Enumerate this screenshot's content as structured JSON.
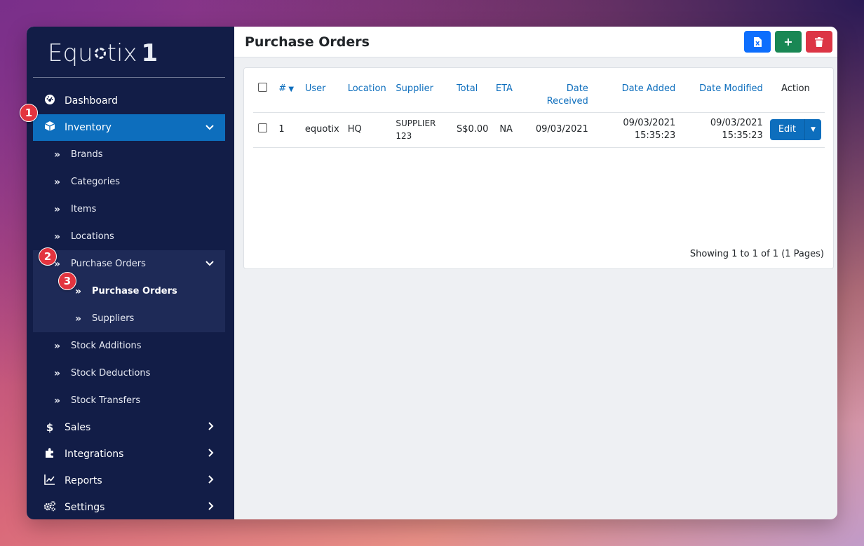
{
  "app": {
    "logo_text": "Equotix",
    "logo_suffix": "1"
  },
  "sidebar": {
    "items": [
      {
        "label": "Dashboard",
        "icon": "dashboard-icon"
      },
      {
        "label": "Inventory",
        "icon": "box-icon"
      },
      {
        "label": "Brands"
      },
      {
        "label": "Categories"
      },
      {
        "label": "Items"
      },
      {
        "label": "Locations"
      },
      {
        "label": "Purchase Orders"
      },
      {
        "label": "Purchase Orders"
      },
      {
        "label": "Suppliers"
      },
      {
        "label": "Stock Additions"
      },
      {
        "label": "Stock Deductions"
      },
      {
        "label": "Stock Transfers"
      },
      {
        "label": "Sales",
        "icon": "dollar-icon"
      },
      {
        "label": "Integrations",
        "icon": "puzzle-icon"
      },
      {
        "label": "Reports",
        "icon": "chart-line-icon"
      },
      {
        "label": "Settings",
        "icon": "gears-icon"
      }
    ]
  },
  "badges": {
    "b1": "1",
    "b2": "2",
    "b3": "3"
  },
  "header": {
    "title": "Purchase Orders",
    "buttons": {
      "export": "excel-icon",
      "add": "+",
      "delete": "trash-icon"
    }
  },
  "table": {
    "columns": {
      "num": "#",
      "user": "User",
      "location": "Location",
      "supplier": "Supplier",
      "total": "Total",
      "eta": "ETA",
      "date_received": "Date Received",
      "date_added": "Date Added",
      "date_modified": "Date Modified",
      "action": "Action"
    },
    "rows": [
      {
        "num": "1",
        "user": "equotix",
        "location": "HQ",
        "supplier": "SUPPLIER 123",
        "total": "S$0.00",
        "eta": "NA",
        "date_received": "09/03/2021",
        "date_added_date": "09/03/2021",
        "date_added_time": "15:35:23",
        "date_modified_date": "09/03/2021",
        "date_modified_time": "15:35:23",
        "edit_label": "Edit"
      }
    ],
    "footer": "Showing 1 to 1 of 1 (1 Pages)"
  },
  "colors": {
    "sidebar_bg": "#121d47",
    "active": "#0d6ebd",
    "badge": "#e3343f"
  }
}
